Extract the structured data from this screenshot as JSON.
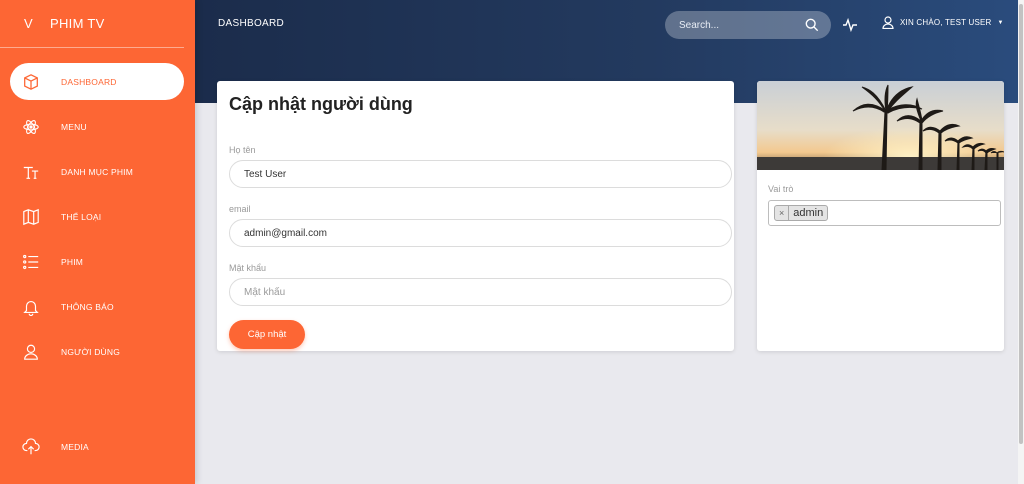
{
  "brand": {
    "mini": "V",
    "name": "PHIM TV"
  },
  "sidebar": {
    "items": [
      {
        "label": "DASHBOARD",
        "icon": "box-icon",
        "active": true
      },
      {
        "label": "MENU",
        "icon": "atom-icon"
      },
      {
        "label": "DANH MỤC PHIM",
        "icon": "text-icon"
      },
      {
        "label": "THỂ LOẠI",
        "icon": "map-icon"
      },
      {
        "label": "PHIM",
        "icon": "list-icon"
      },
      {
        "label": "THÔNG BÁO",
        "icon": "bell-icon"
      },
      {
        "label": "NGƯỜI DÙNG",
        "icon": "user-icon"
      }
    ],
    "media": {
      "label": "MEDIA",
      "icon": "cloud-upload-icon"
    }
  },
  "header": {
    "title": "DASHBOARD",
    "search_placeholder": "Search...",
    "user_greeting": "XIN CHÀO, TEST USER"
  },
  "form": {
    "title": "Cập nhật người dùng",
    "name_label": "Họ tên",
    "name_value": "Test User",
    "email_label": "email",
    "email_value": "admin@gmail.com",
    "password_label": "Mật khẩu",
    "password_placeholder": "Mật khẩu",
    "submit_label": "Cập nhật"
  },
  "roles": {
    "label": "Vai trò",
    "selected": [
      "admin"
    ],
    "remove_symbol": "×"
  },
  "colors": {
    "accent": "#fd6634",
    "header_dark": "#1b2c4b",
    "header_light": "#2a4c7d",
    "background": "#e9e9ee"
  }
}
